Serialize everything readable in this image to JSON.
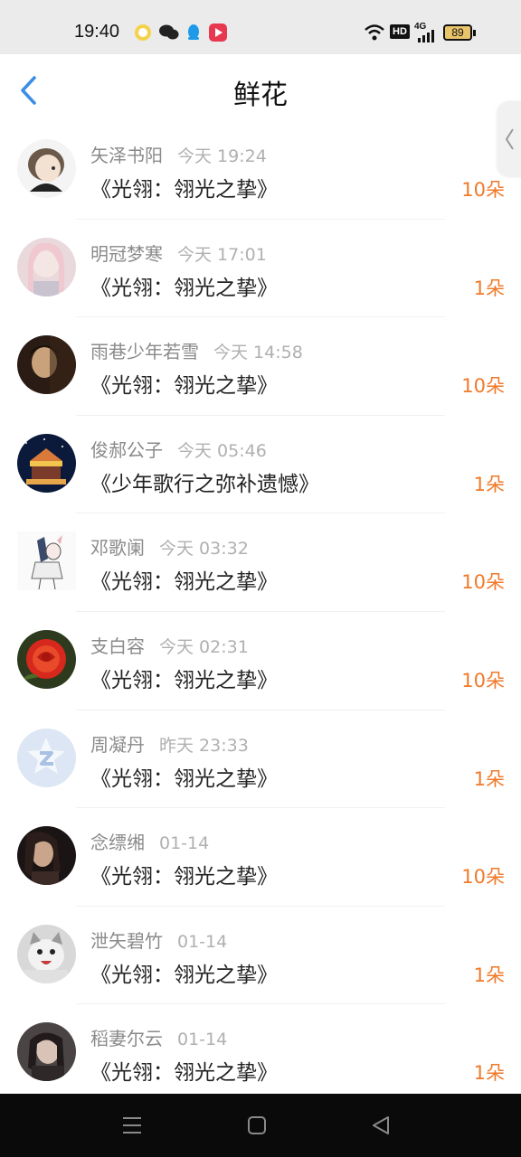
{
  "status": {
    "time": "19:40",
    "hd": "HD",
    "network": "4G",
    "battery": "89"
  },
  "header": {
    "title": "鲜花"
  },
  "icons": {
    "back": "back-arrow-icon",
    "side_tab": "chevron-left-icon",
    "menu": "menu-icon",
    "home": "home-square-icon",
    "back_nav": "triangle-back-icon"
  },
  "colors": {
    "accent": "#3a8ee6",
    "count": "#f07a2a",
    "name": "#8a8a8a",
    "time": "#b0b0b0"
  },
  "items": [
    {
      "name": "矢泽书阳",
      "time": "今天 19:24",
      "book": "《光翎：翎光之挚》",
      "count": "10朵"
    },
    {
      "name": "明冠梦寒",
      "time": "今天 17:01",
      "book": "《光翎：翎光之挚》",
      "count": "1朵"
    },
    {
      "name": "雨巷少年若雪",
      "time": "今天 14:58",
      "book": "《光翎：翎光之挚》",
      "count": "10朵"
    },
    {
      "name": "俊郝公子",
      "time": "今天 05:46",
      "book": "《少年歌行之弥补遗憾》",
      "count": "1朵"
    },
    {
      "name": "邓歌阑",
      "time": "今天 03:32",
      "book": "《光翎：翎光之挚》",
      "count": "10朵"
    },
    {
      "name": "支白容",
      "time": "今天 02:31",
      "book": "《光翎：翎光之挚》",
      "count": "10朵"
    },
    {
      "name": "周凝丹",
      "time": "昨天 23:33",
      "book": "《光翎：翎光之挚》",
      "count": "1朵"
    },
    {
      "name": "念缥缃",
      "time": "01-14",
      "book": "《光翎：翎光之挚》",
      "count": "10朵"
    },
    {
      "name": "泄矢碧竹",
      "time": "01-14",
      "book": "《光翎：翎光之挚》",
      "count": "1朵"
    },
    {
      "name": "稻妻尔云",
      "time": "01-14",
      "book": "《光翎：翎光之挚》",
      "count": "1朵"
    }
  ]
}
